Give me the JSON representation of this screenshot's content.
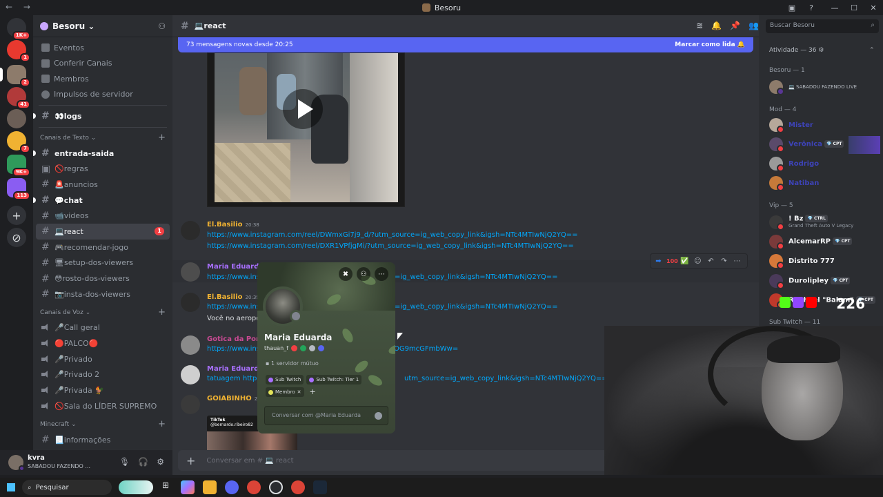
{
  "window": {
    "title": "Besoru",
    "nav": "← →"
  },
  "servers": [
    {
      "name": "server-discord-home",
      "badge": "1K+",
      "color": "#5865f2"
    },
    {
      "name": "server-red",
      "badge": "1",
      "color": "#e8392f"
    },
    {
      "name": "server-avatar-1",
      "badge": "2",
      "color": "#8d7b6b"
    },
    {
      "name": "server-avatar-2",
      "badge": "41",
      "color": "#b13a3a"
    },
    {
      "name": "server-avatar-3",
      "badge": "",
      "color": "#6b5e56"
    },
    {
      "name": "server-s",
      "badge": "7",
      "color": "#f0b232"
    },
    {
      "name": "server-group",
      "badge": "9K+",
      "color": "#2f9a5b"
    },
    {
      "name": "server-purple",
      "badge": "113",
      "color": "#8a5df2"
    }
  ],
  "guild": {
    "name": "Besoru",
    "menu": [
      "Eventos",
      "Conferir Canais",
      "Membros",
      "Impulsos de servidor"
    ]
  },
  "channels": {
    "pinned": {
      "label": "👀logs"
    },
    "text_category": "Canais de Texto",
    "text": [
      {
        "label": "entrada-saida",
        "unread": true
      },
      {
        "label": "🚫regras",
        "unread": false
      },
      {
        "label": "🚨anuncios",
        "unread": false
      },
      {
        "label": "💬chat",
        "unread": true
      },
      {
        "label": "📹videos",
        "unread": false
      },
      {
        "label": "💻react",
        "active": true,
        "mention": "1"
      },
      {
        "label": "🎮recomendar-jogo",
        "unread": false
      },
      {
        "label": "🖥setup-dos-viewers",
        "unread": false
      },
      {
        "label": "😳rosto-dos-viewers",
        "unread": false
      },
      {
        "label": "📷insta-dos-viewers",
        "unread": false
      }
    ],
    "voice_category": "Canais de Voz",
    "voice": [
      "🎤Call geral",
      "🔴PALCO🔴",
      "🎤Privado",
      "🎤Privado 2",
      "🎤Privada 🐓",
      "🚫Sala do LÍDER SUPREMO"
    ],
    "minecraft_category": "Minecraft",
    "minecraft": [
      "📃informações"
    ]
  },
  "user": {
    "name": "kvra",
    "status": "SABADOU FAZENDO ..."
  },
  "header": {
    "channel": "💻react",
    "search_placeholder": "Buscar Besoru"
  },
  "newbar": {
    "text": "73 mensagens novas desde 20:25",
    "action": "Marcar como lida"
  },
  "messages": [
    {
      "author": "El.Basilio",
      "time": "20:38",
      "color": "#f0b232",
      "lines": [
        {
          "text": "https://www.instagram.com/reel/DWmxGi7j9_d/?utm_source=ig_web_copy_link&igsh=NTc4MTIwNjQ2YQ==",
          "link": true
        },
        {
          "text": "https://www.instagram.com/reel/DXR1VPfjgMi/?utm_source=ig_web_copy_link&igsh=NTc4MTIwNjQ2YQ==",
          "link": true
        }
      ]
    },
    {
      "author": "Maria Eduarda",
      "time": "",
      "color": "#a970ff",
      "lines": [
        {
          "text": "https://www.ins",
          "tail": "=ig_web_copy_link&igsh=NTc4MTIwNjQ2YQ==",
          "link": true
        }
      ]
    },
    {
      "author": "El.Basilio",
      "time": "20:39",
      "color": "#f0b232",
      "lines": [
        {
          "text": "https://www.ins",
          "tail": "=ig_web_copy_link&igsh=NTc4MTIwNjQ2YQ==",
          "link": true
        },
        {
          "text": "Você no aeropor",
          "link": false
        }
      ]
    },
    {
      "author": "Gotica da Porra",
      "time": "",
      "color": "#c94a93",
      "lines": [
        {
          "text": "https://www.ins",
          "tail": "JOG9mcGFmbWw=",
          "link": true
        }
      ]
    },
    {
      "author": "Maria Eduarda",
      "time": "",
      "color": "#a970ff",
      "lines": [
        {
          "text": "tatuagem https:",
          "tail": "utm_source=ig_web_copy_link&igsh=NTc4MTIwNjQ2YQ==",
          "link": true
        }
      ]
    },
    {
      "author": "GOIABINHO",
      "time": "20:",
      "color": "#f0b232",
      "lines": []
    }
  ],
  "tiktok": {
    "label": "TikTok",
    "handle": "@bernardo.ribeiro82"
  },
  "composer": {
    "placeholder": "Conversar em # 💻 react"
  },
  "profile": {
    "name": "Maria Eduarda",
    "username": "thauan_f",
    "mutual": "1 servidor mútuo",
    "roles": [
      {
        "label": "Sub Twitch",
        "color": "#a970ff"
      },
      {
        "label": "Sub Twitch: Tier 1",
        "color": "#a970ff"
      },
      {
        "label": "Membro",
        "color": "#e3e35a",
        "removable": true
      }
    ],
    "message_placeholder": "Conversar com @Maria Eduarda"
  },
  "members_panel": {
    "activity": "Atividade — 36",
    "groups": [
      {
        "title": "Besoru — 1",
        "members": [
          {
            "name": "",
            "sub": "💻 SABADOU FAZENDO LIVE",
            "color": "#dbdee1"
          }
        ]
      },
      {
        "title": "Mod — 4",
        "members": [
          {
            "name": "Mister",
            "color": "#5865f2"
          },
          {
            "name": "Verônica",
            "tag": "💎 CPT",
            "color": "#5865f2"
          },
          {
            "name": "Rodrigo",
            "color": "#5865f2"
          },
          {
            "name": "Natiban",
            "color": "#5865f2"
          }
        ]
      },
      {
        "title": "Vip — 5",
        "members": [
          {
            "name": "! Bz",
            "tag": "💎 CTRL",
            "sub": "Grand Theft Auto V Legacy",
            "color": "#f2f3f5"
          },
          {
            "name": "AlcemarRP",
            "tag": "💎 CPT",
            "color": "#f2f3f5"
          },
          {
            "name": "Distrito 777",
            "color": "#f2f3f5"
          },
          {
            "name": "Durolipley",
            "tag": "💎 CPT",
            "color": "#f2f3f5"
          },
          {
            "name": "Raphael \"Balam\"",
            "tag": "💎 CPT",
            "color": "#f2f3f5"
          }
        ]
      }
    ],
    "sub_twitch": "Sub Twitch — 11"
  },
  "stream_overlay": {
    "viewers": "226"
  },
  "taskbar": {
    "search": "Pesquisar"
  }
}
